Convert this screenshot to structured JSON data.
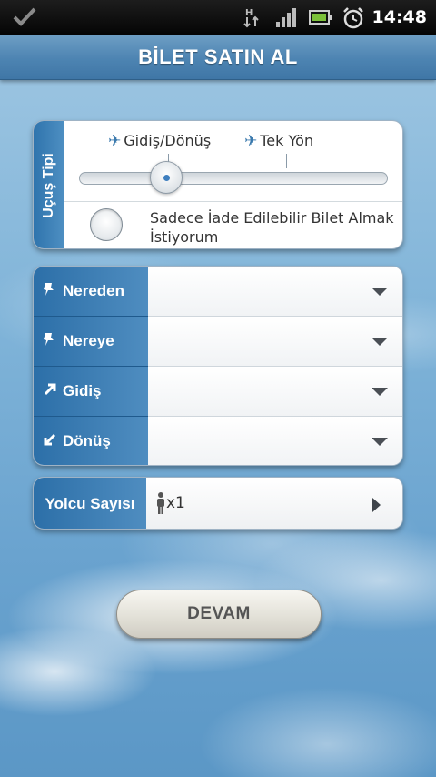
{
  "status_bar": {
    "time": "14:48",
    "icons": [
      "check-icon",
      "data-transfer-icon",
      "signal-icon",
      "battery-icon",
      "alarm-clock-icon"
    ]
  },
  "header": {
    "title": "BİLET SATIN AL"
  },
  "trip_type": {
    "section_label": "Uçuş Tipi",
    "options": [
      "Gidiş/Dönüş",
      "Tek Yön"
    ],
    "selected_option": "Gidiş/Dönüş",
    "refundable_label": "Sadece İade Edilebilir Bilet Almak İstiyorum",
    "refundable_checked": false
  },
  "route": {
    "rows": [
      {
        "label": "Nereden",
        "icon": "pin-icon",
        "value": ""
      },
      {
        "label": "Nereye",
        "icon": "pin-icon",
        "value": ""
      },
      {
        "label": "Gidiş",
        "icon": "arrow-up-right-icon",
        "value": ""
      },
      {
        "label": "Dönüş",
        "icon": "arrow-down-left-icon",
        "value": ""
      }
    ]
  },
  "passengers": {
    "label": "Yolcu Sayısı",
    "count_text": "x1"
  },
  "actions": {
    "continue_label": "DEVAM"
  },
  "colors": {
    "accent_blue": "#3a7bb3",
    "title_bar": "#4d84b2",
    "sky": "#7fb3d8"
  }
}
